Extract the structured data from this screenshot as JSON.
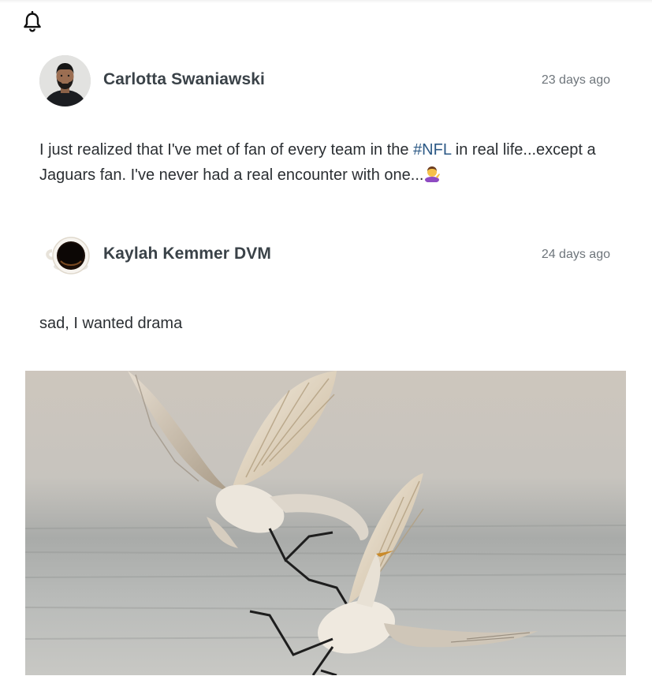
{
  "header": {
    "bell_icon": "bell-icon"
  },
  "posts": [
    {
      "author": "Carlotta Swaniawski",
      "time": "23 days ago",
      "avatar": "man-portrait-avatar",
      "text_before": "I just realized that I've met of fan of every team in the ",
      "hashtag": "#NFL",
      "text_after": " in real life...except a Jaguars fan. I've never had a real encounter with one...",
      "emoji": "person-tipping-hand-emoji"
    },
    {
      "author": "Kaylah Kemmer DVM",
      "time": "24 days ago",
      "avatar": "coffee-cup-avatar",
      "text": "sad, I wanted drama",
      "image": "fighting-egrets-photo"
    }
  ],
  "colors": {
    "hashtag": "#2d5a86",
    "author": "#3a4248",
    "timestamp": "#6e757b"
  }
}
